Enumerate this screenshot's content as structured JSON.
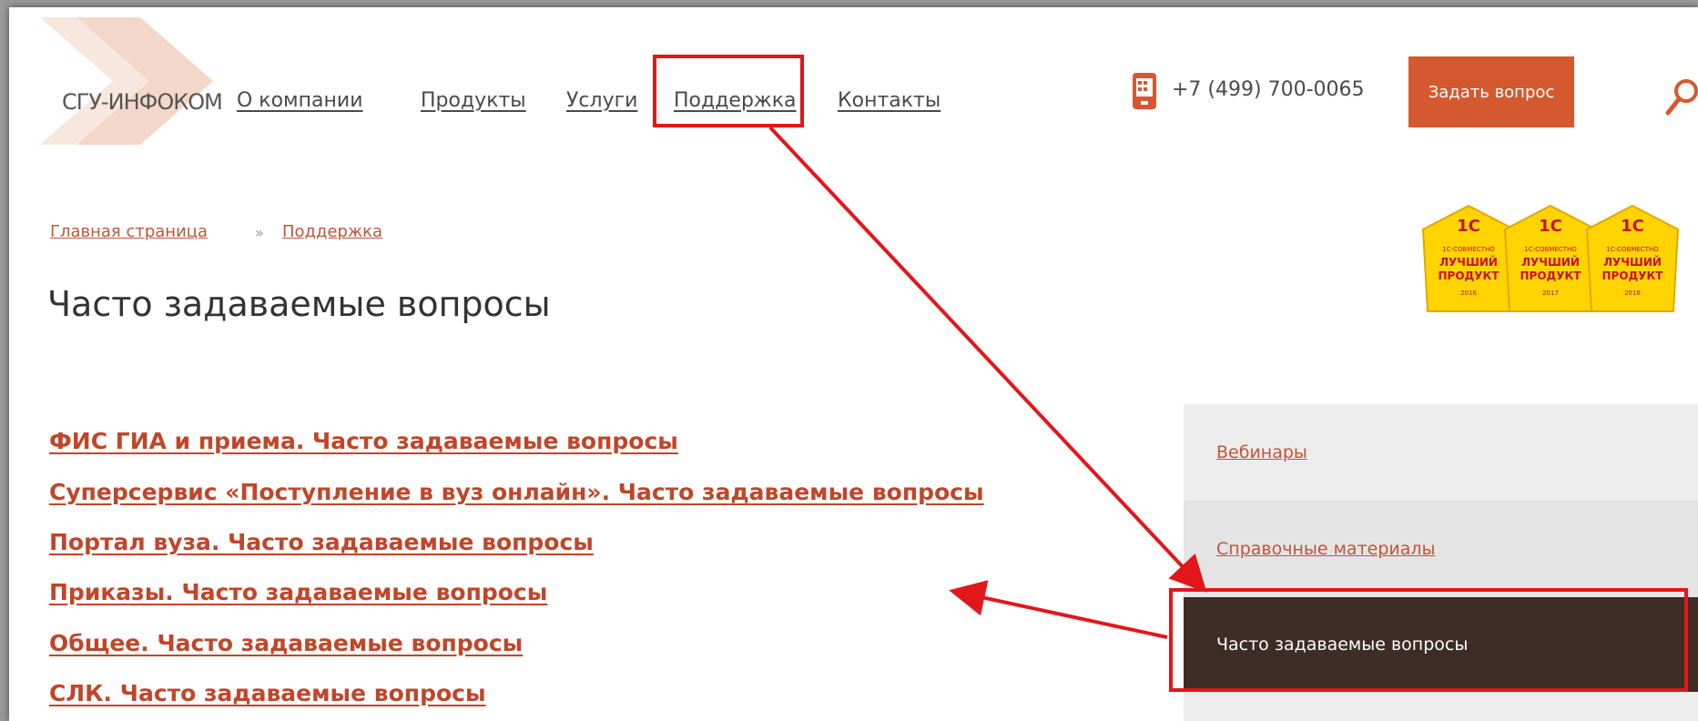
{
  "header": {
    "logo_text": "СГУ-ИНФОКОМ",
    "nav": [
      {
        "label": "О компании"
      },
      {
        "label": "Продукты"
      },
      {
        "label": "Услуги"
      },
      {
        "label": "Поддержка"
      },
      {
        "label": "Контакты"
      }
    ],
    "phone": "+7 (499) 700-0065",
    "ask_button": "Задать вопрос"
  },
  "breadcrumb": {
    "items": [
      "Главная страница",
      "Поддержка"
    ],
    "separator": "»"
  },
  "page_title": "Часто задаваемые вопросы",
  "faq_links": [
    "ФИС ГИА и приема. Часто задаваемые вопросы",
    "Суперсервис «Поступление в вуз онлайн». Часто задаваемые вопросы",
    "Портал вуза. Часто задаваемые вопросы",
    "Приказы. Часто задаваемые вопросы",
    "Общее. Часто задаваемые вопросы",
    "СЛК. Часто задаваемые вопросы"
  ],
  "sidebar": {
    "items": [
      {
        "label": "Вебинары"
      },
      {
        "label": "Справочные материалы"
      },
      {
        "label": "Часто задаваемые вопросы"
      }
    ]
  },
  "badges": [
    {
      "brand": "1С",
      "line1": "1С-СОВМЕСТНО",
      "line2": "ЛУЧШИЙ",
      "line3": "ПРОДУКТ",
      "year": "2016"
    },
    {
      "brand": "1С",
      "line1": "1С-СОВМЕСТНО",
      "line2": "ЛУЧШИЙ",
      "line3": "ПРОДУКТ",
      "year": "2017"
    },
    {
      "brand": "1С",
      "line1": "1С-СОВМЕСТНО",
      "line2": "ЛУЧШИЙ",
      "line3": "ПРОДУКТ",
      "year": "2018"
    }
  ],
  "colors": {
    "accent": "#d5592e",
    "link": "#c0462a",
    "highlight": "#e1171b",
    "sidebar_active": "#3e2c26",
    "badge_yellow": "#ffd400"
  }
}
